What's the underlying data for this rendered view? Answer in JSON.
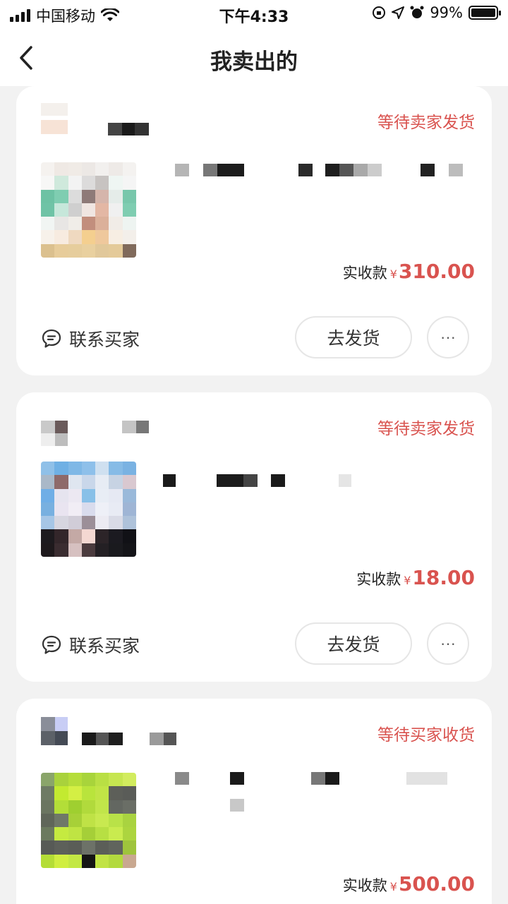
{
  "status_bar": {
    "carrier": "中国移动",
    "time": "下午4:33",
    "battery": "99%"
  },
  "nav": {
    "title": "我卖出的",
    "back_icon": "chevron-left-icon"
  },
  "orders": [
    {
      "status": "等待卖家发货",
      "price_label": "实收款",
      "currency": "¥",
      "amount": "310.00",
      "contact_label": "联系买家",
      "action_label": "去发货",
      "more_label": "···"
    },
    {
      "status": "等待卖家发货",
      "price_label": "实收款",
      "currency": "¥",
      "amount": "18.00",
      "contact_label": "联系买家",
      "action_label": "去发货",
      "more_label": "···"
    },
    {
      "status": "等待买家收货",
      "price_label": "实收款",
      "currency": "¥",
      "amount": "500.00"
    }
  ],
  "colors": {
    "accent_red": "#d9534f",
    "background": "#f2f2f2",
    "card": "#ffffff"
  }
}
